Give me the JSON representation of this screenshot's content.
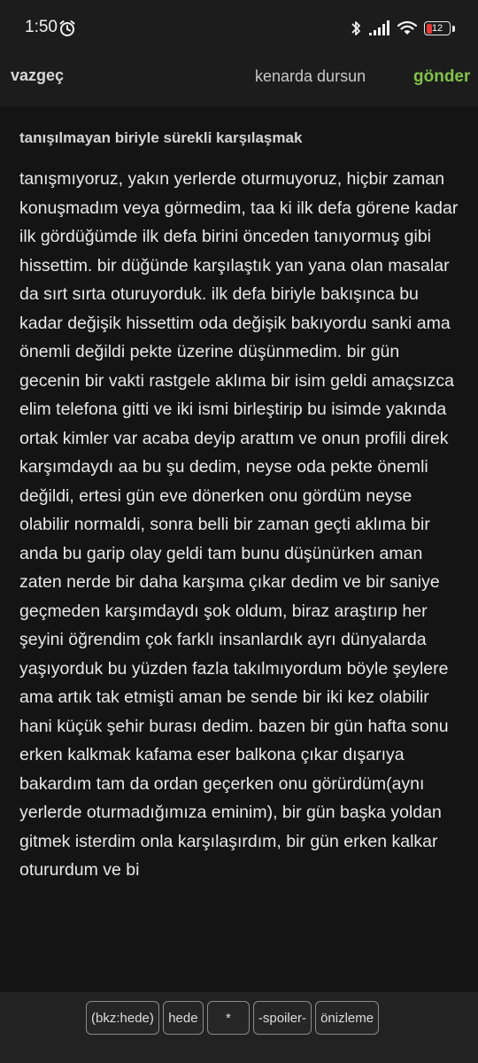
{
  "status_bar": {
    "time": "1:50",
    "battery_level": 12,
    "battery_color": "#e53935"
  },
  "toolbar": {
    "cancel_label": "vazgeç",
    "draft_label": "kenarda dursun",
    "send_label": "gönder",
    "send_color": "#81c14b"
  },
  "entry": {
    "title": "tanışılmayan biriyle sürekli karşılaşmak",
    "body": "tanışmıyoruz, yakın yerlerde oturmuyoruz, hiçbir zaman konuşmadım veya görmedim, taa ki ilk defa görene kadar ilk gördüğümde ilk defa birini önceden tanıyormuş gibi hissettim. bir düğünde karşılaştık yan yana olan masalar da sırt sırta oturuyorduk. ilk defa biriyle bakışınca bu kadar değişik hissettim oda değişik bakıyordu sanki ama önemli değildi pekte üzerine düşünmedim. bir gün gecenin bir vakti rastgele aklıma bir isim geldi amaçsızca elim telefona gitti ve iki ismi birleştirip bu isimde yakında ortak kimler var acaba deyip arattım ve onun profili direk karşımdaydı aa bu şu dedim, neyse oda pekte önemli değildi, ertesi gün eve dönerken onu gördüm neyse olabilir normaldi, sonra belli bir zaman geçti aklıma bir anda bu garip olay geldi tam bunu düşünürken aman zaten nerde bir daha karşıma çıkar dedim ve bir saniye geçmeden karşımdaydı şok oldum, biraz araştırıp her şeyini öğrendim çok farklı insanlardık ayrı dünyalarda yaşıyorduk bu yüzden fazla takılmıyordum böyle şeylere ama artık tak etmişti aman be sende bir iki kez olabilir hani küçük şehir burası dedim. bazen bir gün hafta sonu erken kalkmak kafama eser balkona çıkar dışarıya bakardım tam da ordan geçerken onu görürdüm(aynı yerlerde oturmadığımıza eminim), bir gün başka yoldan gitmek isterdim onla karşılaşırdım, bir gün erken kalkar otururdum ve bi"
  },
  "format_bar": {
    "buttons": [
      "(bkz:hede)",
      "hede",
      "*",
      "-spoiler-",
      "önizleme"
    ]
  }
}
